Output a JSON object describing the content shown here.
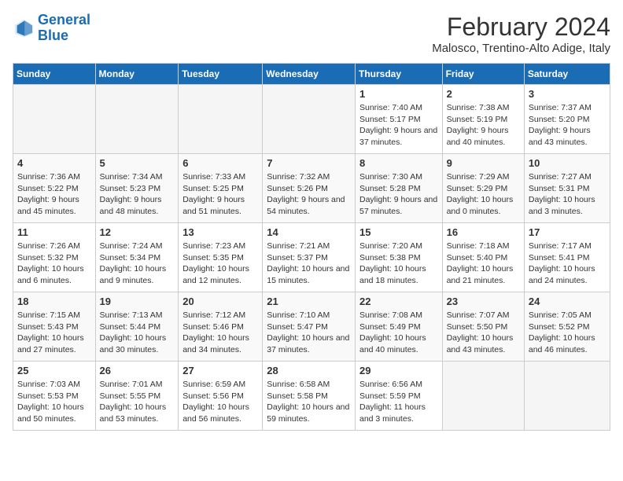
{
  "header": {
    "logo_line1": "General",
    "logo_line2": "Blue",
    "month": "February 2024",
    "location": "Malosco, Trentino-Alto Adige, Italy"
  },
  "weekdays": [
    "Sunday",
    "Monday",
    "Tuesday",
    "Wednesday",
    "Thursday",
    "Friday",
    "Saturday"
  ],
  "weeks": [
    [
      {
        "day": "",
        "empty": true
      },
      {
        "day": "",
        "empty": true
      },
      {
        "day": "",
        "empty": true
      },
      {
        "day": "",
        "empty": true
      },
      {
        "day": "1",
        "sunrise": "7:40 AM",
        "sunset": "5:17 PM",
        "daylight": "9 hours and 37 minutes."
      },
      {
        "day": "2",
        "sunrise": "7:38 AM",
        "sunset": "5:19 PM",
        "daylight": "9 hours and 40 minutes."
      },
      {
        "day": "3",
        "sunrise": "7:37 AM",
        "sunset": "5:20 PM",
        "daylight": "9 hours and 43 minutes."
      }
    ],
    [
      {
        "day": "4",
        "sunrise": "7:36 AM",
        "sunset": "5:22 PM",
        "daylight": "9 hours and 45 minutes."
      },
      {
        "day": "5",
        "sunrise": "7:34 AM",
        "sunset": "5:23 PM",
        "daylight": "9 hours and 48 minutes."
      },
      {
        "day": "6",
        "sunrise": "7:33 AM",
        "sunset": "5:25 PM",
        "daylight": "9 hours and 51 minutes."
      },
      {
        "day": "7",
        "sunrise": "7:32 AM",
        "sunset": "5:26 PM",
        "daylight": "9 hours and 54 minutes."
      },
      {
        "day": "8",
        "sunrise": "7:30 AM",
        "sunset": "5:28 PM",
        "daylight": "9 hours and 57 minutes."
      },
      {
        "day": "9",
        "sunrise": "7:29 AM",
        "sunset": "5:29 PM",
        "daylight": "10 hours and 0 minutes."
      },
      {
        "day": "10",
        "sunrise": "7:27 AM",
        "sunset": "5:31 PM",
        "daylight": "10 hours and 3 minutes."
      }
    ],
    [
      {
        "day": "11",
        "sunrise": "7:26 AM",
        "sunset": "5:32 PM",
        "daylight": "10 hours and 6 minutes."
      },
      {
        "day": "12",
        "sunrise": "7:24 AM",
        "sunset": "5:34 PM",
        "daylight": "10 hours and 9 minutes."
      },
      {
        "day": "13",
        "sunrise": "7:23 AM",
        "sunset": "5:35 PM",
        "daylight": "10 hours and 12 minutes."
      },
      {
        "day": "14",
        "sunrise": "7:21 AM",
        "sunset": "5:37 PM",
        "daylight": "10 hours and 15 minutes."
      },
      {
        "day": "15",
        "sunrise": "7:20 AM",
        "sunset": "5:38 PM",
        "daylight": "10 hours and 18 minutes."
      },
      {
        "day": "16",
        "sunrise": "7:18 AM",
        "sunset": "5:40 PM",
        "daylight": "10 hours and 21 minutes."
      },
      {
        "day": "17",
        "sunrise": "7:17 AM",
        "sunset": "5:41 PM",
        "daylight": "10 hours and 24 minutes."
      }
    ],
    [
      {
        "day": "18",
        "sunrise": "7:15 AM",
        "sunset": "5:43 PM",
        "daylight": "10 hours and 27 minutes."
      },
      {
        "day": "19",
        "sunrise": "7:13 AM",
        "sunset": "5:44 PM",
        "daylight": "10 hours and 30 minutes."
      },
      {
        "day": "20",
        "sunrise": "7:12 AM",
        "sunset": "5:46 PM",
        "daylight": "10 hours and 34 minutes."
      },
      {
        "day": "21",
        "sunrise": "7:10 AM",
        "sunset": "5:47 PM",
        "daylight": "10 hours and 37 minutes."
      },
      {
        "day": "22",
        "sunrise": "7:08 AM",
        "sunset": "5:49 PM",
        "daylight": "10 hours and 40 minutes."
      },
      {
        "day": "23",
        "sunrise": "7:07 AM",
        "sunset": "5:50 PM",
        "daylight": "10 hours and 43 minutes."
      },
      {
        "day": "24",
        "sunrise": "7:05 AM",
        "sunset": "5:52 PM",
        "daylight": "10 hours and 46 minutes."
      }
    ],
    [
      {
        "day": "25",
        "sunrise": "7:03 AM",
        "sunset": "5:53 PM",
        "daylight": "10 hours and 50 minutes."
      },
      {
        "day": "26",
        "sunrise": "7:01 AM",
        "sunset": "5:55 PM",
        "daylight": "10 hours and 53 minutes."
      },
      {
        "day": "27",
        "sunrise": "6:59 AM",
        "sunset": "5:56 PM",
        "daylight": "10 hours and 56 minutes."
      },
      {
        "day": "28",
        "sunrise": "6:58 AM",
        "sunset": "5:58 PM",
        "daylight": "10 hours and 59 minutes."
      },
      {
        "day": "29",
        "sunrise": "6:56 AM",
        "sunset": "5:59 PM",
        "daylight": "11 hours and 3 minutes."
      },
      {
        "day": "",
        "empty": true
      },
      {
        "day": "",
        "empty": true
      }
    ]
  ],
  "labels": {
    "sunrise": "Sunrise:",
    "sunset": "Sunset:",
    "daylight": "Daylight:"
  }
}
